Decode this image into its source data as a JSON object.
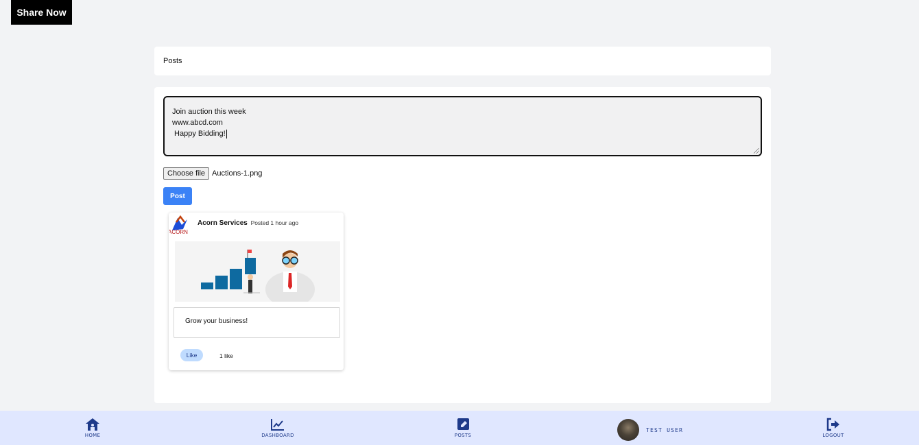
{
  "brand": {
    "title": "Share Now"
  },
  "posts_header": {
    "title": "Posts"
  },
  "composer": {
    "text": "Join auction this week\nwww.abcd.com\n Happy Bidding!",
    "choose_file_label": "Choose file",
    "file_name": "Auctions-1.png",
    "post_label": "Post"
  },
  "post": {
    "author": "Acorn Services",
    "posted": "Posted 1 hour ago",
    "content": "Grow your business!",
    "like_label": "Like",
    "like_count": "1 like",
    "avatar_text": "ACORN"
  },
  "bottom_nav": {
    "home": "HOME",
    "dashboard": "DASHBOARD",
    "posts": "POSTS",
    "user": "TEST USER",
    "logout": "LOGOUT"
  },
  "colors": {
    "accent": "#3b82f6",
    "nav_bg": "#e0e7ff",
    "nav_fg": "#1e3a8a",
    "like_bg": "#bfdbfe"
  }
}
